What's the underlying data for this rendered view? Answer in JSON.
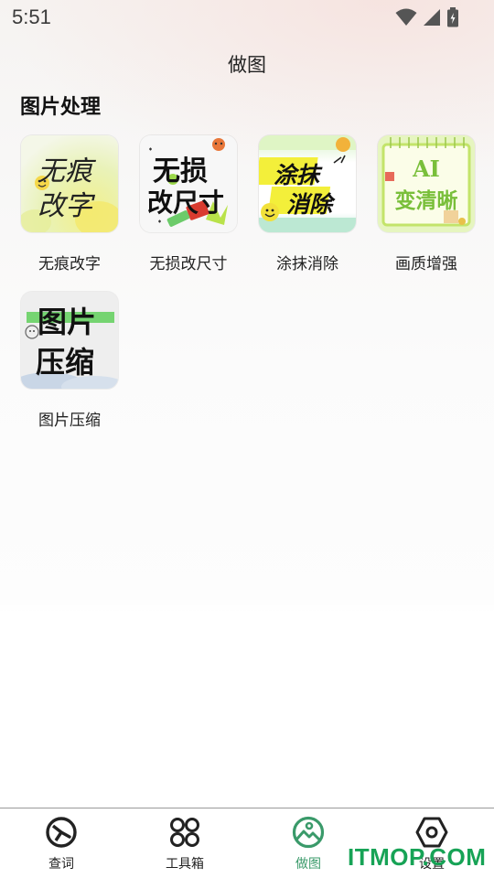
{
  "status_bar": {
    "time": "5:51",
    "icons": [
      "wifi-icon",
      "signal-icon",
      "battery-charging-icon"
    ]
  },
  "header": {
    "title": "做图"
  },
  "section": {
    "title": "图片处理"
  },
  "tools": [
    {
      "label": "无痕改字",
      "thumb_text": [
        "无痕",
        "改字"
      ]
    },
    {
      "label": "无损改尺寸",
      "thumb_text": [
        "无损",
        "改尺寸"
      ]
    },
    {
      "label": "涂抹消除",
      "thumb_text": [
        "涂抹",
        "消除"
      ]
    },
    {
      "label": "画质增强",
      "thumb_text": [
        "AI",
        "变清晰"
      ]
    },
    {
      "label": "图片压缩",
      "thumb_text": [
        "图片",
        "压缩"
      ]
    }
  ],
  "bottom_nav": {
    "items": [
      {
        "label": "查词",
        "icon": "search-word-icon"
      },
      {
        "label": "工具箱",
        "icon": "toolbox-grid-icon"
      },
      {
        "label": "做图",
        "icon": "image-icon",
        "active": true
      },
      {
        "label": "设置",
        "icon": "settings-hexagon-icon"
      }
    ],
    "active_color": "#3a9a6a"
  },
  "watermark": {
    "text": "ITMOP.COM",
    "color": "#17a356"
  }
}
